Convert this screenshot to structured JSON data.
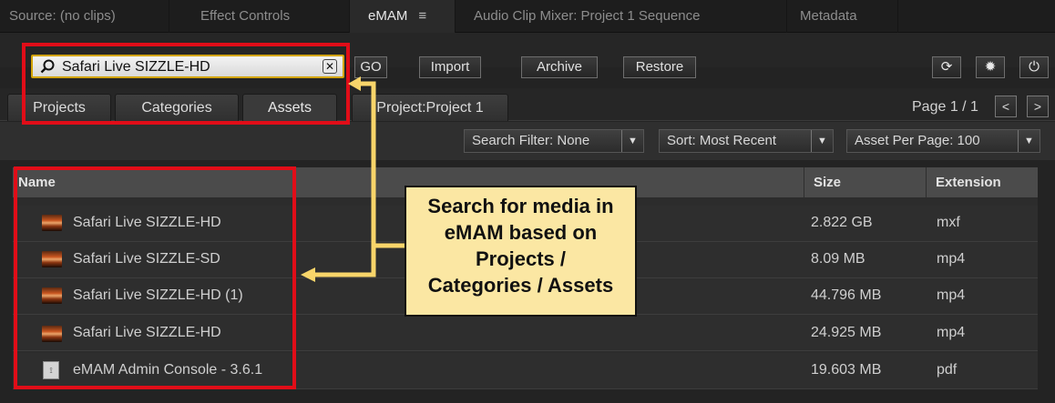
{
  "tabs": [
    {
      "label": "Source: (no clips)"
    },
    {
      "label": "Effect Controls"
    },
    {
      "label": "eMAM",
      "menu_icon": "hamburger-icon"
    },
    {
      "label": "Audio Clip Mixer: Project 1 Sequence"
    },
    {
      "label": "Metadata"
    }
  ],
  "search": {
    "value": "Safari Live SIZZLE-HD",
    "icon": "search-icon"
  },
  "toolbar": {
    "go_label": "GO",
    "import_label": "Import",
    "archive_label": "Archive",
    "restore_label": "Restore",
    "right_icons": [
      "refresh-icon",
      "gear-icon",
      "power-icon"
    ]
  },
  "subtabs": [
    {
      "label": "Projects"
    },
    {
      "label": "Categories"
    },
    {
      "label": "Assets"
    },
    {
      "label": "Project:Project 1"
    }
  ],
  "pagination": {
    "label": "Page 1 / 1",
    "prev": "<",
    "next": ">"
  },
  "filters": {
    "search_filter": "Search Filter: None",
    "sort": "Sort: Most Recent",
    "per_page": "Asset Per Page: 100"
  },
  "table": {
    "columns": [
      "Name",
      "Size",
      "Extension"
    ],
    "rows": [
      {
        "name": "Safari Live SIZZLE-HD",
        "size": "2.822 GB",
        "ext": "mxf",
        "icon": "video-thumbnail-icon"
      },
      {
        "name": "Safari Live SIZZLE-SD",
        "size": "8.09 MB",
        "ext": "mp4",
        "icon": "video-thumbnail-icon"
      },
      {
        "name": "Safari Live SIZZLE-HD (1)",
        "size": "44.796 MB",
        "ext": "mp4",
        "icon": "video-thumbnail-icon"
      },
      {
        "name": "Safari Live SIZZLE-HD",
        "size": "24.925 MB",
        "ext": "mp4",
        "icon": "video-thumbnail-icon"
      },
      {
        "name": "eMAM Admin Console - 3.6.1",
        "size": "19.603 MB",
        "ext": "pdf",
        "icon": "pdf-file-icon"
      }
    ]
  },
  "callout": {
    "lines": [
      "Search for media in",
      "eMAM based on",
      "Projects /",
      "Categories / Assets"
    ]
  },
  "colors": {
    "highlight": "#e10d18",
    "callout_bg": "#fbe7a3",
    "search_border": "#d3a400"
  }
}
